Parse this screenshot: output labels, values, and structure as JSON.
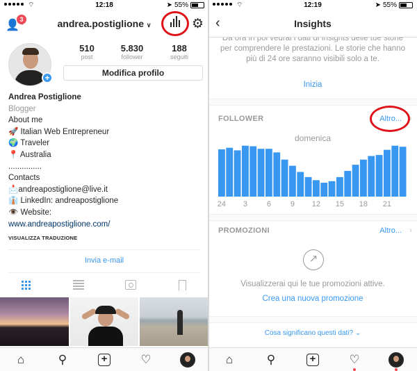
{
  "left": {
    "status": {
      "time": "12:18",
      "battery": "55%",
      "battery_level": 0.55
    },
    "header": {
      "username": "andrea.postiglione",
      "notif_count": "3"
    },
    "stats": [
      {
        "value": "510",
        "label": "post"
      },
      {
        "value": "5.830",
        "label": "follower"
      },
      {
        "value": "188",
        "label": "seguiti"
      }
    ],
    "edit_profile": "Modifica profilo",
    "bio": {
      "name": "Andrea Postiglione",
      "category": "Blogger",
      "about": "About me",
      "line1": "🚀 Italian Web Entrepreneur",
      "line2": "🌍 Traveler",
      "line3": "📍 Australia",
      "dots": "...............",
      "contacts": "Contacts",
      "email": "📩andreapostiglione@live.it",
      "linkedin": "👔 LinkedIn: andreapostiglione",
      "website_label": "👁️ Website:",
      "website_url": "www.andreapostiglione.com/",
      "translate": "VISUALIZZA TRADUZIONE"
    },
    "email_button": "Invia e-mail"
  },
  "right": {
    "status": {
      "time": "12:19",
      "battery": "55%",
      "battery_level": 0.55
    },
    "title": "Insights",
    "intro": "Da ora in poi vedrai i dati di Insights delle tue storie per comprendere le prestazioni. Le storie che hanno più di 24 ore saranno visibili solo a te.",
    "start": "Inizia",
    "follower_section": {
      "title": "FOLLOWER",
      "more": "Altro..."
    },
    "day_label": "domenica",
    "promo_section": {
      "title": "PROMOZIONI",
      "more": "Altro..."
    },
    "promo_text": "Visualizzerai qui le tue promozioni attive.",
    "promo_link": "Crea una nuova promozione",
    "bottom_link": "Cosa significano questi dati? ⌄"
  },
  "chart_data": {
    "type": "bar",
    "title": "",
    "xlabel": "",
    "ylabel": "",
    "x_tick_labels": [
      "24",
      "3",
      "6",
      "9",
      "12",
      "15",
      "18",
      "21"
    ],
    "x_tick_hours": [
      0,
      3,
      6,
      9,
      12,
      15,
      18,
      21
    ],
    "hours": [
      0,
      1,
      2,
      3,
      4,
      5,
      6,
      7,
      8,
      9,
      10,
      11,
      12,
      13,
      14,
      15,
      16,
      17,
      18,
      19,
      20,
      21,
      22,
      23
    ],
    "values": [
      0.92,
      0.95,
      0.9,
      0.99,
      0.98,
      0.93,
      0.93,
      0.86,
      0.72,
      0.6,
      0.48,
      0.38,
      0.32,
      0.27,
      0.3,
      0.38,
      0.5,
      0.62,
      0.72,
      0.79,
      0.81,
      0.91,
      0.99,
      0.97
    ],
    "color": "#3897f0"
  },
  "colors": {
    "accent": "#3897f0",
    "highlight": "#e0131a",
    "notification": "#ed4956"
  }
}
